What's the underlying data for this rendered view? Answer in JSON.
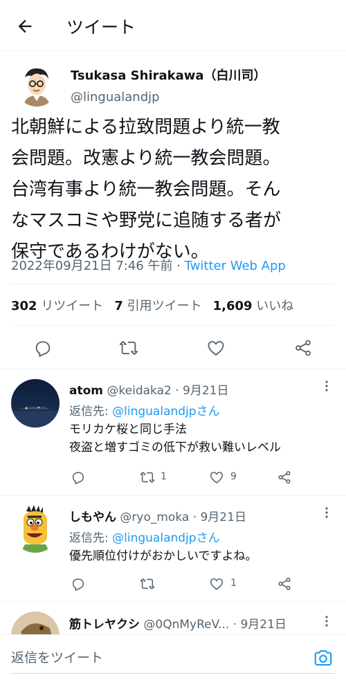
{
  "header": {
    "title": "ツイート"
  },
  "tweet": {
    "author_name": "Tsukasa Shirakawa（白川司）",
    "author_handle": "@lingualandjp",
    "text_lines": [
      "北朝鮮による拉致問題より統一教",
      "会問題。改憲より統一教会問題。",
      "台湾有事より統一教会問題。そん",
      "なマスコミや野党に追随する者が",
      "保守であるわけがない。"
    ],
    "timestamp": "2022年09月21日 7:46 午前",
    "separator": " · ",
    "source": "Twitter Web App",
    "stats": {
      "retweets": "302",
      "retweets_label": "リツイート",
      "quotes": "7",
      "quotes_label": "引用ツイート",
      "likes": "1,609",
      "likes_label": "いいね"
    }
  },
  "replies": [
    {
      "name": "atom",
      "handle": "@keidaka2",
      "date": "· 9月21日",
      "reply_prefix": "返信先: ",
      "reply_to": "@lingualandjpさん",
      "text_lines": [
        "モリカケ桜と同じ手法",
        "夜盗と増すゴミの低下が救い難いレベル"
      ],
      "retweets": "1",
      "likes": "9"
    },
    {
      "name": "しもやん",
      "handle": "@ryo_moka",
      "date": "· 9月21日",
      "reply_prefix": "返信先: ",
      "reply_to": "@lingualandjpさん",
      "text_lines": [
        "優先順位付けがおかしいですよね。"
      ],
      "retweets": "",
      "likes": "1"
    },
    {
      "name": "筋トレヤクシ",
      "handle": "@0QnMyReV...",
      "date": "· 9月21日"
    }
  ],
  "reply_bar": {
    "placeholder": "返信をツイート"
  },
  "colors": {
    "accent": "#1d9bf0",
    "secondary_text": "#536471",
    "divider": "#eff3f4"
  },
  "icons": [
    "back-arrow-icon",
    "reply-icon",
    "retweet-icon",
    "like-icon",
    "share-icon",
    "more-icon",
    "camera-icon"
  ]
}
